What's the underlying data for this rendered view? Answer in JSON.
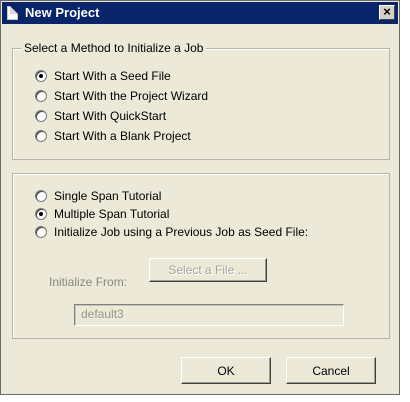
{
  "window": {
    "title": "New Project",
    "close_glyph": "×"
  },
  "method_group": {
    "legend": "Select a Method to Initialize a Job",
    "options": [
      {
        "label": "Start With a Seed File",
        "checked": true
      },
      {
        "label": "Start With the Project Wizard",
        "checked": false
      },
      {
        "label": "Start With QuickStart",
        "checked": false
      },
      {
        "label": "Start With a Blank Project",
        "checked": false
      }
    ]
  },
  "seed_group": {
    "options": [
      {
        "label": "Single Span Tutorial",
        "checked": false
      },
      {
        "label": "Multiple Span Tutorial",
        "checked": true
      },
      {
        "label": "Initialize Job using a Previous Job as Seed File:",
        "checked": false
      }
    ],
    "initialize_from_label": "Initialize From:",
    "select_file_label": "Select a File ...",
    "file_value": "default3"
  },
  "buttons": {
    "ok": "OK",
    "cancel": "Cancel"
  }
}
